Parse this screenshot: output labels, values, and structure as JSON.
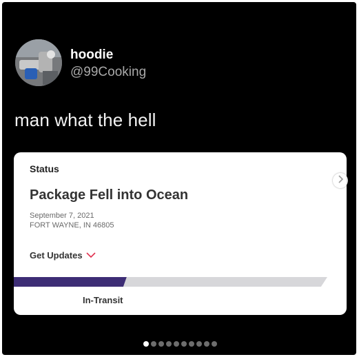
{
  "tweet": {
    "display_name": "hoodie",
    "handle": "@99Cooking",
    "text": "man what the hell"
  },
  "tracking_card": {
    "status_label": "Status",
    "headline": "Package Fell into Ocean",
    "date": "September 7, 2021",
    "location": "FORT WAYNE, IN 46805",
    "get_updates_label": "Get Updates",
    "progress_fraction": 0.36,
    "progress_label": "In-Transit",
    "progress_color": "#3d2d75",
    "chevron_color": "#e0304e"
  },
  "carousel": {
    "page_count": 10,
    "active_index": 0,
    "next_icon": "chevron-right-icon"
  }
}
